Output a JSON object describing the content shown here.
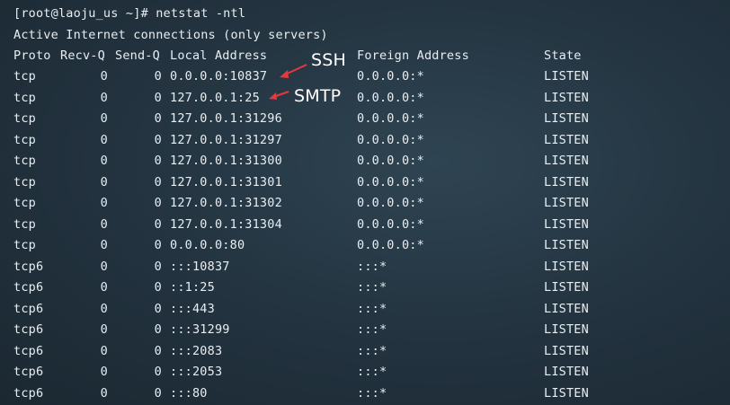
{
  "prompt": "[root@laoju_us ~]# netstat -ntl",
  "title": "Active Internet connections (only servers)",
  "headers": {
    "proto": "Proto",
    "recvq": "Recv-Q",
    "sendq": "Send-Q",
    "local": "Local Address",
    "foreign": "Foreign Address",
    "state": "State"
  },
  "rows": [
    {
      "proto": "tcp",
      "recvq": "0",
      "sendq": "0",
      "local": "0.0.0.0:10837",
      "foreign": "0.0.0.0:*",
      "state": "LISTEN"
    },
    {
      "proto": "tcp",
      "recvq": "0",
      "sendq": "0",
      "local": "127.0.0.1:25",
      "foreign": "0.0.0.0:*",
      "state": "LISTEN"
    },
    {
      "proto": "tcp",
      "recvq": "0",
      "sendq": "0",
      "local": "127.0.0.1:31296",
      "foreign": "0.0.0.0:*",
      "state": "LISTEN"
    },
    {
      "proto": "tcp",
      "recvq": "0",
      "sendq": "0",
      "local": "127.0.0.1:31297",
      "foreign": "0.0.0.0:*",
      "state": "LISTEN"
    },
    {
      "proto": "tcp",
      "recvq": "0",
      "sendq": "0",
      "local": "127.0.0.1:31300",
      "foreign": "0.0.0.0:*",
      "state": "LISTEN"
    },
    {
      "proto": "tcp",
      "recvq": "0",
      "sendq": "0",
      "local": "127.0.0.1:31301",
      "foreign": "0.0.0.0:*",
      "state": "LISTEN"
    },
    {
      "proto": "tcp",
      "recvq": "0",
      "sendq": "0",
      "local": "127.0.0.1:31302",
      "foreign": "0.0.0.0:*",
      "state": "LISTEN"
    },
    {
      "proto": "tcp",
      "recvq": "0",
      "sendq": "0",
      "local": "127.0.0.1:31304",
      "foreign": "0.0.0.0:*",
      "state": "LISTEN"
    },
    {
      "proto": "tcp",
      "recvq": "0",
      "sendq": "0",
      "local": "0.0.0.0:80",
      "foreign": "0.0.0.0:*",
      "state": "LISTEN"
    },
    {
      "proto": "tcp6",
      "recvq": "0",
      "sendq": "0",
      "local": ":::10837",
      "foreign": ":::*",
      "state": "LISTEN"
    },
    {
      "proto": "tcp6",
      "recvq": "0",
      "sendq": "0",
      "local": "::1:25",
      "foreign": ":::*",
      "state": "LISTEN"
    },
    {
      "proto": "tcp6",
      "recvq": "0",
      "sendq": "0",
      "local": ":::443",
      "foreign": ":::*",
      "state": "LISTEN"
    },
    {
      "proto": "tcp6",
      "recvq": "0",
      "sendq": "0",
      "local": ":::31299",
      "foreign": ":::*",
      "state": "LISTEN"
    },
    {
      "proto": "tcp6",
      "recvq": "0",
      "sendq": "0",
      "local": ":::2083",
      "foreign": ":::*",
      "state": "LISTEN"
    },
    {
      "proto": "tcp6",
      "recvq": "0",
      "sendq": "0",
      "local": ":::2053",
      "foreign": ":::*",
      "state": "LISTEN"
    },
    {
      "proto": "tcp6",
      "recvq": "0",
      "sendq": "0",
      "local": ":::80",
      "foreign": ":::*",
      "state": "LISTEN"
    }
  ],
  "annotations": {
    "ssh": "SSH",
    "smtp": "SMTP",
    "arrow_color": "#e8383d"
  }
}
